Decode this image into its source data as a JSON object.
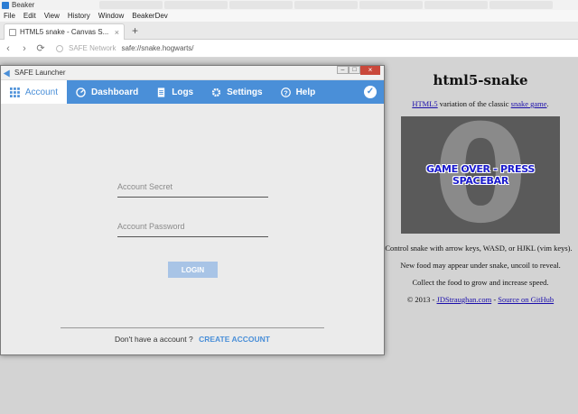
{
  "browser": {
    "app_title": "Beaker",
    "menu": [
      "File",
      "Edit",
      "View",
      "History",
      "Window",
      "BeakerDev"
    ],
    "tab": {
      "label": "HTML5 snake - Canvas S...",
      "close": "×"
    },
    "new_tab": "+",
    "nav": {
      "back": "‹",
      "forward": "›",
      "reload": "⟳"
    },
    "address": {
      "security_label": "SAFE Network",
      "url": "safe://snake.hogwarts/"
    }
  },
  "launcher": {
    "title": "SAFE Launcher",
    "controls": {
      "minimize": "–",
      "maximize": "□",
      "close": "×"
    },
    "nav": [
      {
        "label": "Account",
        "icon": "grid-icon"
      },
      {
        "label": "Dashboard",
        "icon": "gauge-icon"
      },
      {
        "label": "Logs",
        "icon": "document-icon"
      },
      {
        "label": "Settings",
        "icon": "gear-icon"
      },
      {
        "label": "Help",
        "icon": "question-icon"
      }
    ],
    "status_icon": "✓",
    "form": {
      "secret_placeholder": "Account Secret",
      "password_placeholder": "Account Password",
      "login_label": "LOGIN",
      "signup_text": "Don't have a account ?",
      "signup_link": "CREATE ACCOUNT"
    }
  },
  "page": {
    "title": "html5-snake",
    "intro_link": "HTML5",
    "intro_text": " variation of the classic ",
    "intro_link2": "snake game",
    "intro_end": ".",
    "score": "0",
    "game_over": "GAME OVER - PRESS SPACEBAR",
    "info1": "Control snake with arrow keys, WASD, or HJKL (vim keys).",
    "info2": "New food may appear under snake, uncoil to reveal.",
    "info3": "Collect the food to grow and increase speed.",
    "footer_prefix": "© 2013 - ",
    "footer_link1": "JDStraughan.com",
    "footer_sep": " - ",
    "footer_link2": "Source on GitHub"
  }
}
